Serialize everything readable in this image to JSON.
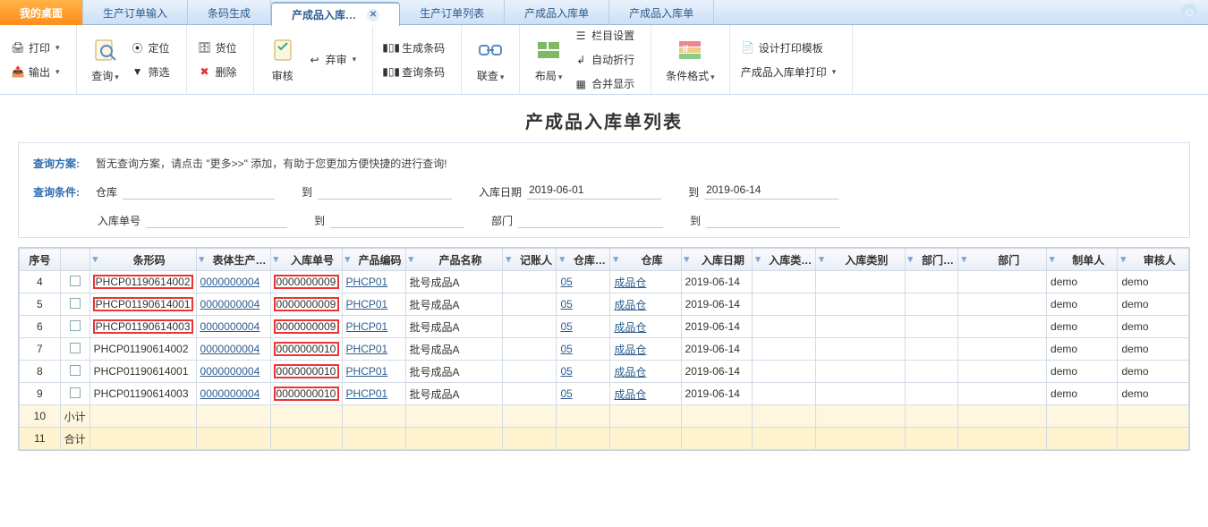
{
  "tabs": {
    "items": [
      {
        "label": "我的桌面"
      },
      {
        "label": "生产订单输入"
      },
      {
        "label": "条码生成"
      },
      {
        "label": "产成品入库…"
      },
      {
        "label": "生产订单列表"
      },
      {
        "label": "产成品入库单"
      },
      {
        "label": "产成品入库单"
      }
    ]
  },
  "ribbon": {
    "print": "打印",
    "output": "输出",
    "query": "查询",
    "locate": "定位",
    "filter": "筛选",
    "slot": "货位",
    "delete": "删除",
    "abandon": "弃审",
    "audit": "审核",
    "genbc": "生成条码",
    "querybc": "查询条码",
    "link": "联查",
    "layout": "布局",
    "colcfg": "栏目设置",
    "autowrap": "自动折行",
    "merge": "合并显示",
    "condfmt": "条件格式",
    "tpl": "设计打印模板",
    "rcprint": "产成品入库单打印"
  },
  "page_title": "产成品入库单列表",
  "panel": {
    "plan_label": "查询方案",
    "plan_hint": "暂无查询方案，请点击 \"更多>>\" 添加，有助于您更加方便快捷的进行查询!",
    "cond_label": "查询条件",
    "filters": {
      "warehouse": "仓库",
      "to1": "到",
      "indate": "入库日期",
      "indate_from": "2019-06-01",
      "to2": "到",
      "indate_to": "2019-06-14",
      "docno": "入库单号",
      "to3": "到",
      "dept": "部门",
      "to4": "到"
    }
  },
  "columns": {
    "seq": "序号",
    "checkbox": "",
    "barcode": "条形码",
    "bodyprod": "表体生产…",
    "indocno": "入库单号",
    "prodcode": "产品编码",
    "prodname": "产品名称",
    "booker": "记账人",
    "whshort": "仓库…",
    "wh": "仓库",
    "indate": "入库日期",
    "intypeshort": "入库类…",
    "intype": "入库类别",
    "deptshort": "部门…",
    "dept": "部门",
    "creator": "制单人",
    "auditor": "审核人"
  },
  "rows": [
    {
      "seq": "4",
      "barcode": "PHCP01190614002",
      "bodyprod": "0000000004",
      "indocno": "0000000009",
      "prodcode": "PHCP01",
      "prodname": "批号成品A",
      "whshort": "05",
      "wh": "成品仓",
      "indate": "2019-06-14",
      "creator": "demo",
      "auditor": "demo",
      "red_barcode": true,
      "red_indoc": true
    },
    {
      "seq": "5",
      "barcode": "PHCP01190614001",
      "bodyprod": "0000000004",
      "indocno": "0000000009",
      "prodcode": "PHCP01",
      "prodname": "批号成品A",
      "whshort": "05",
      "wh": "成品仓",
      "indate": "2019-06-14",
      "creator": "demo",
      "auditor": "demo",
      "red_barcode": true,
      "red_indoc": true
    },
    {
      "seq": "6",
      "barcode": "PHCP01190614003",
      "bodyprod": "0000000004",
      "indocno": "0000000009",
      "prodcode": "PHCP01",
      "prodname": "批号成品A",
      "whshort": "05",
      "wh": "成品仓",
      "indate": "2019-06-14",
      "creator": "demo",
      "auditor": "demo",
      "red_barcode": true,
      "red_indoc": true
    },
    {
      "seq": "7",
      "barcode": "PHCP01190614002",
      "bodyprod": "0000000004",
      "indocno": "0000000010",
      "prodcode": "PHCP01",
      "prodname": "批号成品A",
      "whshort": "05",
      "wh": "成品仓",
      "indate": "2019-06-14",
      "creator": "demo",
      "auditor": "demo",
      "red_barcode": false,
      "red_indoc": true
    },
    {
      "seq": "8",
      "barcode": "PHCP01190614001",
      "bodyprod": "0000000004",
      "indocno": "0000000010",
      "prodcode": "PHCP01",
      "prodname": "批号成品A",
      "whshort": "05",
      "wh": "成品仓",
      "indate": "2019-06-14",
      "creator": "demo",
      "auditor": "demo",
      "red_barcode": false,
      "red_indoc": true
    },
    {
      "seq": "9",
      "barcode": "PHCP01190614003",
      "bodyprod": "0000000004",
      "indocno": "0000000010",
      "prodcode": "PHCP01",
      "prodname": "批号成品A",
      "whshort": "05",
      "wh": "成品仓",
      "indate": "2019-06-14",
      "creator": "demo",
      "auditor": "demo",
      "red_barcode": false,
      "red_indoc": true
    }
  ],
  "subtotal": {
    "seq": "10",
    "label": "小计"
  },
  "total": {
    "seq": "11",
    "label": "合计"
  }
}
